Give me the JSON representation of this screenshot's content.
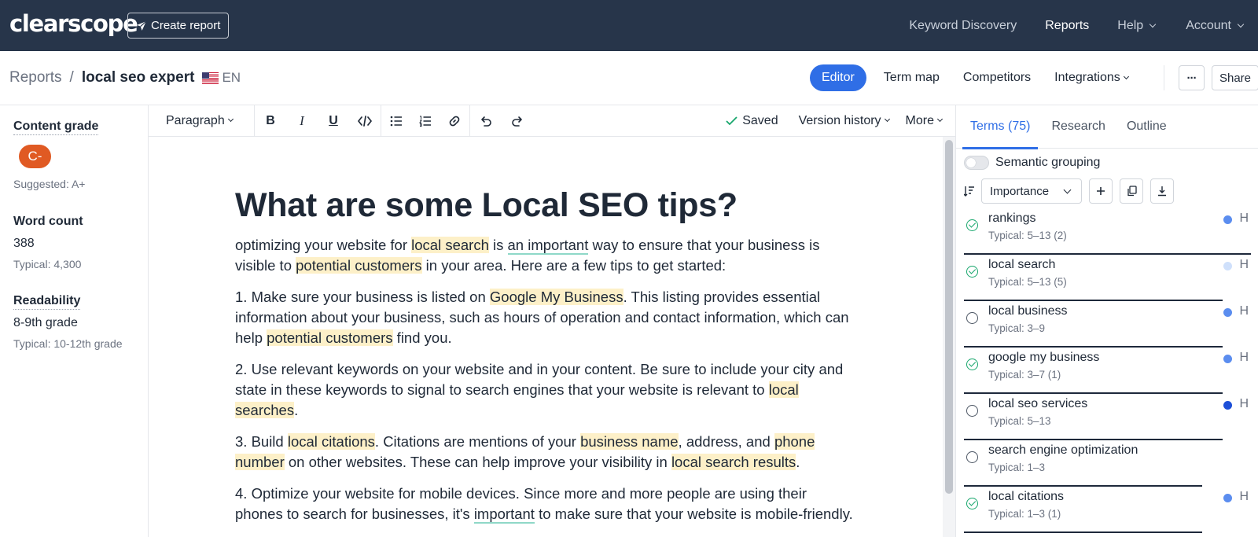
{
  "nav": {
    "logo": "clearscope",
    "create_report": "Create report",
    "items": [
      {
        "label": "Keyword Discovery",
        "active": false,
        "dropdown": false
      },
      {
        "label": "Reports",
        "active": true,
        "dropdown": false
      },
      {
        "label": "Help",
        "active": false,
        "dropdown": true
      },
      {
        "label": "Account",
        "active": false,
        "dropdown": true
      }
    ]
  },
  "header": {
    "breadcrumb_root": "Reports",
    "breadcrumb_sep": "/",
    "report_title": "local seo expert",
    "language": "EN",
    "tabs": {
      "editor": "Editor",
      "term_map": "Term map",
      "competitors": "Competitors",
      "integrations": "Integrations"
    },
    "more_label": "···",
    "share_label": "Share"
  },
  "left": {
    "content_grade_label": "Content grade",
    "grade": "C-",
    "suggested": "Suggested: A+",
    "word_count_label": "Word count",
    "word_count": "388",
    "word_count_typical": "Typical: 4,300",
    "readability_label": "Readability",
    "readability": "8-9th grade",
    "readability_typical": "Typical: 10-12th grade"
  },
  "toolbar": {
    "paragraph": "Paragraph",
    "saved": "Saved",
    "version_history": "Version history",
    "more": "More"
  },
  "doc": {
    "title": "What are some Local SEO tips?",
    "p1": {
      "a": "optimizing your website for ",
      "b": "local search",
      "c": " is ",
      "d": "an important",
      "e": " way to ensure that your business is visible to ",
      "f": "potential customers",
      "g": " in your area. Here are a few tips to get started:"
    },
    "p2": {
      "a": "1. Make sure your business is listed on ",
      "b": "Google My Business",
      "c": ". This listing provides essential information about your business, such as hours of operation and contact information, which can help ",
      "d": "potential customers",
      "e": " find you."
    },
    "p3": {
      "a": "2. Use relevant keywords on your website and in your content. Be sure to include your city and state in these keywords to signal to search engines that your website is relevant to ",
      "b": "local searches",
      "c": "."
    },
    "p4": {
      "a": "3. Build ",
      "b": "local citations",
      "c": ". Citations are mentions of your ",
      "d": "business name",
      "e": ", address, and ",
      "f": "phone number",
      "g": " on other websites. These can help improve your visibility in ",
      "h": "local search results",
      "i": "."
    },
    "p5": {
      "a": "4. Optimize your website for mobile devices. Since more and more people are using their phones to search for businesses, it's ",
      "b": "important",
      "c": " to make sure that your website is mobile-friendly."
    }
  },
  "right": {
    "tabs": {
      "terms": "Terms (75)",
      "research": "Research",
      "outline": "Outline"
    },
    "semantic_grouping": "Semantic grouping",
    "sort_by": "Importance",
    "terms": [
      {
        "name": "rankings",
        "typical": "Typical: 5–13 (2)",
        "done": true,
        "dot": "#5b8def",
        "h": "H",
        "bar": 1.0
      },
      {
        "name": "local search",
        "typical": "Typical: 5–13 (5)",
        "done": true,
        "dot": "#cfe0fb",
        "h": "H",
        "bar": 0.9
      },
      {
        "name": "local business",
        "typical": "Typical: 3–9",
        "done": false,
        "dot": "#5b8def",
        "h": "H",
        "bar": 0.9
      },
      {
        "name": "google my business",
        "typical": "Typical: 3–7 (1)",
        "done": true,
        "dot": "#5b8def",
        "h": "H",
        "bar": 0.9
      },
      {
        "name": "local seo services",
        "typical": "Typical: 5–13",
        "done": false,
        "dot": "#1d4fd8",
        "h": "H",
        "bar": 0.9
      },
      {
        "name": "search engine optimization",
        "typical": "Typical: 1–3",
        "done": false,
        "dot": "",
        "h": "",
        "bar": 0.83
      },
      {
        "name": "local citations",
        "typical": "Typical: 1–3 (1)",
        "done": true,
        "dot": "#5b8def",
        "h": "H",
        "bar": 0.83
      }
    ]
  }
}
